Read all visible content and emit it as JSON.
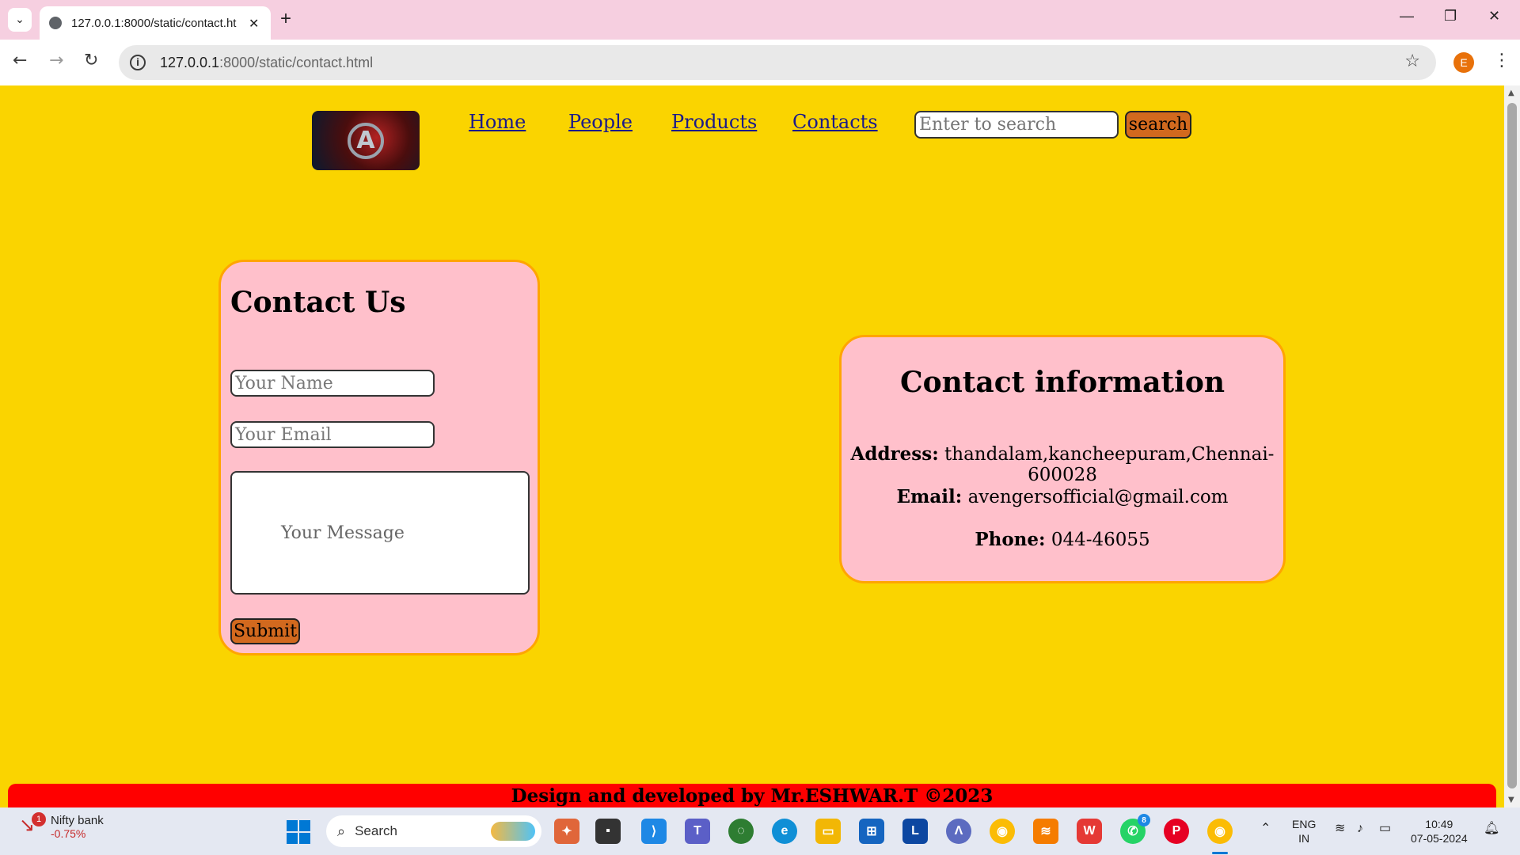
{
  "browser": {
    "tab_title": "127.0.0.1:8000/static/contact.ht",
    "url_host": "127.0.0.1",
    "url_rest": ":8000/static/contact.html",
    "profile_initial": "E"
  },
  "nav": {
    "links": [
      "Home",
      "People",
      "Products",
      "Contacts"
    ],
    "search_placeholder": "Enter to search",
    "search_button": "search"
  },
  "contact_form": {
    "title": "Contact Us",
    "name_placeholder": "Your Name",
    "email_placeholder": "Your Email",
    "message_placeholder": "Your Message",
    "submit_label": "Submit"
  },
  "contact_info": {
    "title": "Contact information",
    "address_label": "Address:",
    "address_value": "thandalam,kancheepuram,Chennai-600028",
    "email_label": "Email:",
    "email_value": "avengersofficial@gmail.com",
    "phone_label": "Phone:",
    "phone_value": "044-46055"
  },
  "footer": {
    "text": "Design and developed by Mr.ESHWAR.T ©2023"
  },
  "taskbar": {
    "stock_name": "Nifty bank",
    "stock_change": "-0.75%",
    "stock_badge": "1",
    "search_label": "Search",
    "whatsapp_badge": "8",
    "lang_line1": "ENG",
    "lang_line2": "IN",
    "time": "10:49",
    "date": "07-05-2024"
  },
  "colors": {
    "page_bg": "#fad400",
    "card_bg": "#ffc0cb",
    "card_border": "#ffa500",
    "button_bg": "#d2691e",
    "footer_bg": "#ff0000",
    "link": "#1a1a8a"
  }
}
